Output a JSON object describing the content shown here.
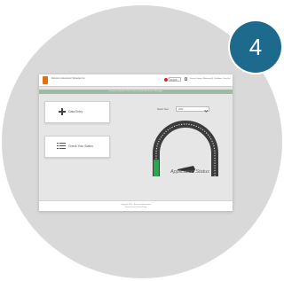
{
  "badge": {
    "number": "4"
  },
  "app": {
    "brand_text": "Resource Assessment Strategies Inc.",
    "language": "English",
    "user_text": "Dennis, Ewing | Welcome(0) | Sr Admin | Log Out"
  },
  "banner": {
    "text": "Resources Based for 2030 | Click to Send and Receive Messages"
  },
  "cards": [
    {
      "label": "Data Entry",
      "icon": "plus-icon"
    },
    {
      "label": "Check Your Status",
      "icon": "checklist-icon"
    }
  ],
  "status": {
    "select_label": "Select Year",
    "select_value": "2024",
    "gauge_title": "Application Status",
    "progress": 0.12,
    "colors": {
      "arc": "#3c3c3c",
      "fill": "#2ea44f",
      "needle": "#333333"
    }
  },
  "footer": {
    "line1": "Copyright 2024 - Resource Assessment",
    "line2": "Terms of Use | Privacy Policy"
  }
}
